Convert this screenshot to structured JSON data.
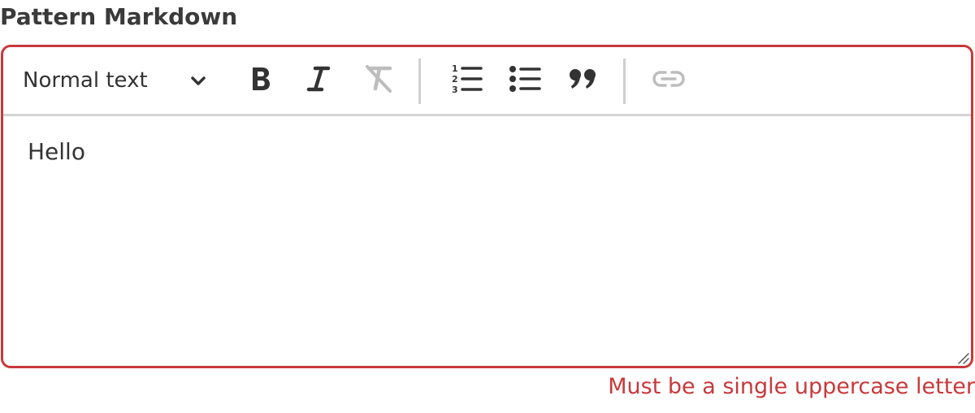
{
  "field": {
    "label": "Pattern Markdown",
    "error": "Must be a single uppercase letter"
  },
  "toolbar": {
    "format_select_value": "Normal text",
    "buttons": [
      {
        "name": "bold",
        "icon": "bold-icon",
        "enabled": true
      },
      {
        "name": "italic",
        "icon": "italic-icon",
        "enabled": true
      },
      {
        "name": "clear-formatting",
        "icon": "clear-format-icon",
        "enabled": false
      },
      {
        "name": "ordered-list",
        "icon": "ordered-list-icon",
        "enabled": true
      },
      {
        "name": "bullet-list",
        "icon": "bullet-list-icon",
        "enabled": true
      },
      {
        "name": "blockquote",
        "icon": "quote-icon",
        "enabled": true
      },
      {
        "name": "link",
        "icon": "link-icon",
        "enabled": false
      }
    ]
  },
  "editor": {
    "content": "Hello"
  },
  "colors": {
    "error": "#c8393b",
    "icon": "#333333",
    "icon_disabled": "#bdbdbd",
    "divider": "#cfcfcf"
  }
}
